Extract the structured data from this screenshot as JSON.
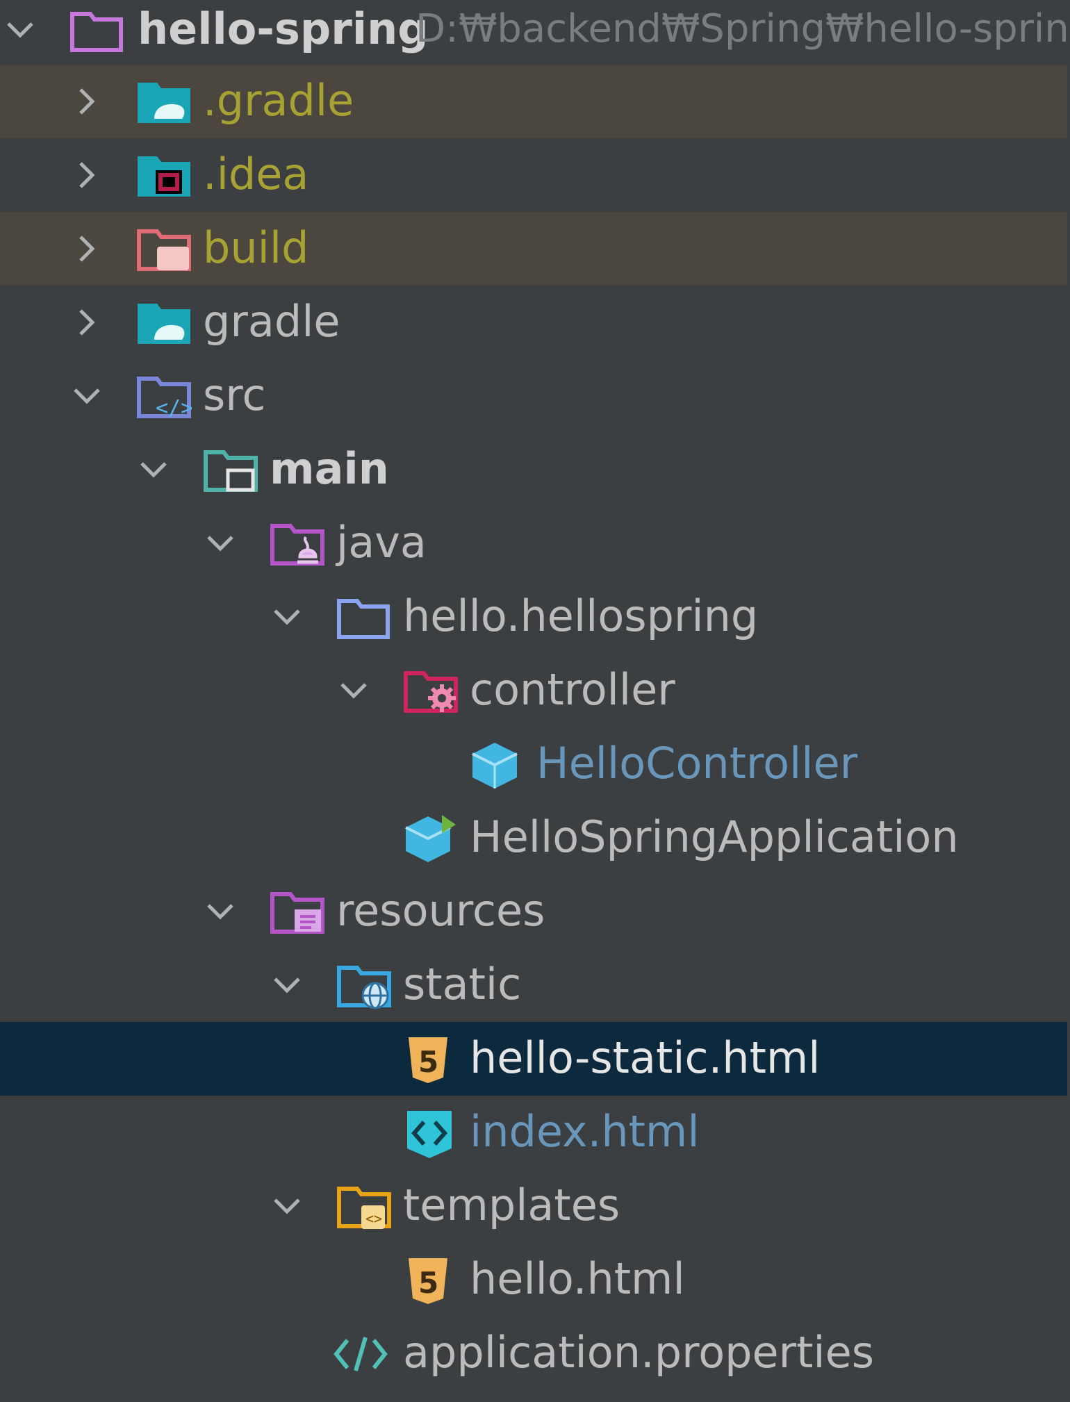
{
  "project": {
    "name": "hello-spring",
    "path": "D:₩backend₩Spring₩hello-sprin"
  },
  "tree": {
    "gradle_hidden": ".gradle",
    "idea": ".idea",
    "build": "build",
    "gradle": "gradle",
    "src": "src",
    "main": "main",
    "java": "java",
    "package": "hello.hellospring",
    "controller": "controller",
    "hello_controller": "HelloController",
    "app": "HelloSpringApplication",
    "resources": "resources",
    "static": "static",
    "hello_static": "hello-static.html",
    "index": "index.html",
    "templates": "templates",
    "hello_html": "hello.html",
    "app_props": "application.properties"
  },
  "colors": {
    "background": "#3c3f41",
    "excluded_row": "#4b473e",
    "selected_row": "#0d293e",
    "excluded_text": "#a8a234",
    "modified_text": "#6897bb"
  }
}
